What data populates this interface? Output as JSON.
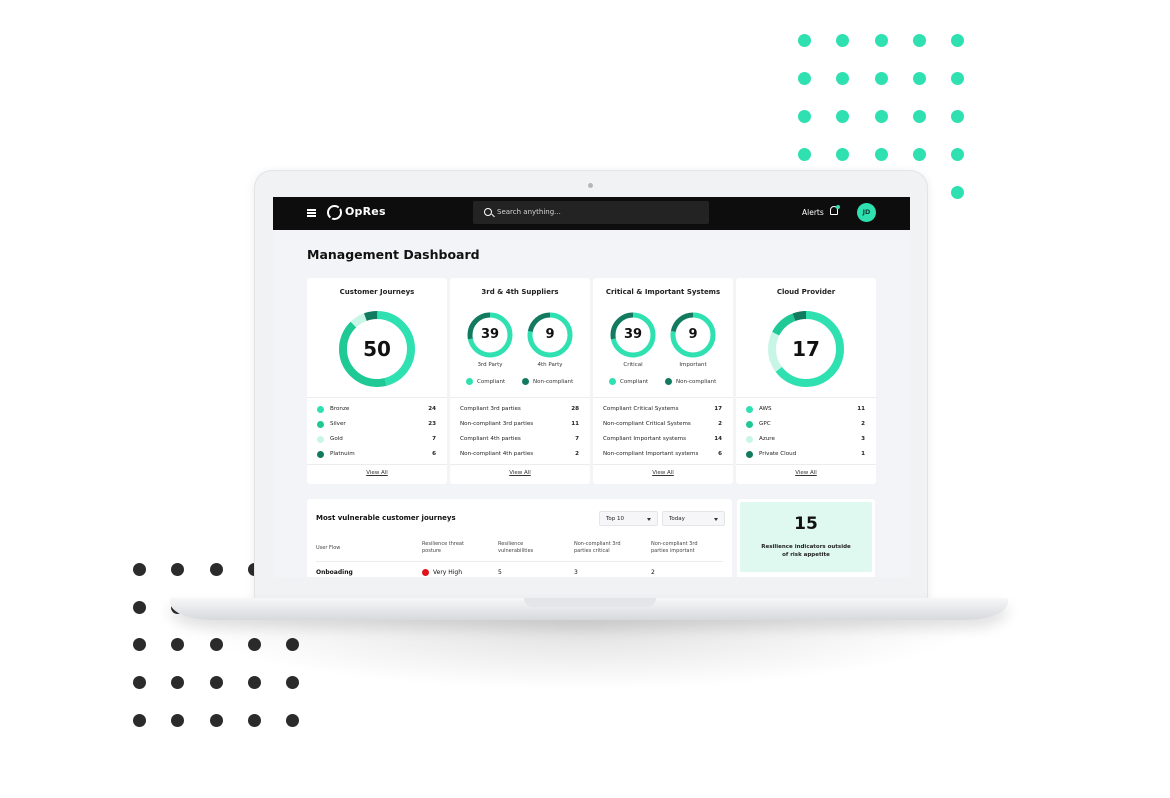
{
  "app": {
    "name": "OpRes"
  },
  "topbar": {
    "search_placeholder": "Search anything...",
    "alerts_label": "Alerts",
    "avatar_initials": "JD"
  },
  "page": {
    "title": "Management Dashboard"
  },
  "colors": {
    "accent": "#2fe0b0",
    "dark_green": "#127a5e",
    "mid_green": "#1ec996",
    "light_green": "#c8f6e6",
    "alert_red": "#e0131a",
    "dot_dark": "#2b2b2b"
  },
  "cards": {
    "customer_journeys": {
      "title": "Customer Journeys",
      "total": "50",
      "rows": [
        {
          "label": "Bronze",
          "value": "24"
        },
        {
          "label": "Silver",
          "value": "23"
        },
        {
          "label": "Gold",
          "value": "7"
        },
        {
          "label": "Platnuim",
          "value": "6"
        }
      ],
      "view_all": "View All"
    },
    "suppliers": {
      "title": "3rd & 4th Suppliers",
      "donut1": {
        "value": "39",
        "label": "3rd Party"
      },
      "donut2": {
        "value": "9",
        "label": "4th Party"
      },
      "legend": {
        "compliant": "Compliant",
        "non_compliant": "Non-compliant"
      },
      "rows": [
        {
          "label": "Compliant 3rd parties",
          "value": "28"
        },
        {
          "label": "Non-compliant 3rd parties",
          "value": "11"
        },
        {
          "label": "Compliant 4th parties",
          "value": "7"
        },
        {
          "label": "Non-compliant 4th parties",
          "value": "2"
        }
      ],
      "view_all": "View All"
    },
    "systems": {
      "title": "Critical & Important Systems",
      "donut1": {
        "value": "39",
        "label": "Critical"
      },
      "donut2": {
        "value": "9",
        "label": "Important"
      },
      "legend": {
        "compliant": "Compliant",
        "non_compliant": "Non-compliant"
      },
      "rows": [
        {
          "label": "Compliant Critical Systems",
          "value": "17"
        },
        {
          "label": "Non-compliant Critical Systems",
          "value": "2"
        },
        {
          "label": "Compliant Important systems",
          "value": "14"
        },
        {
          "label": "Non-compliant Important systems",
          "value": "6"
        }
      ],
      "view_all": "View All"
    },
    "cloud": {
      "title": "Cloud Provider",
      "total": "17",
      "rows": [
        {
          "label": "AWS",
          "value": "11"
        },
        {
          "label": "GPC",
          "value": "2"
        },
        {
          "label": "Azure",
          "value": "3"
        },
        {
          "label": "Private Cloud",
          "value": "1"
        }
      ],
      "view_all": "View All"
    }
  },
  "vulnerable": {
    "title": "Most vulnerable customer journeys",
    "filter_top": "Top 10",
    "filter_time": "Today",
    "headers": [
      "User Flow",
      "Resilience threat posture",
      "Resilience vulnerabilities",
      "Non-compliant 3rd parties critical",
      "Non-compliant 3rd parties important"
    ],
    "rows": [
      {
        "flow": "Onboading",
        "posture": "Very High",
        "vulns": "5",
        "crit": "3",
        "imp": "2"
      }
    ]
  },
  "kpi": {
    "value": "15",
    "text": "Resilience indicators outside of risk appetite"
  }
}
